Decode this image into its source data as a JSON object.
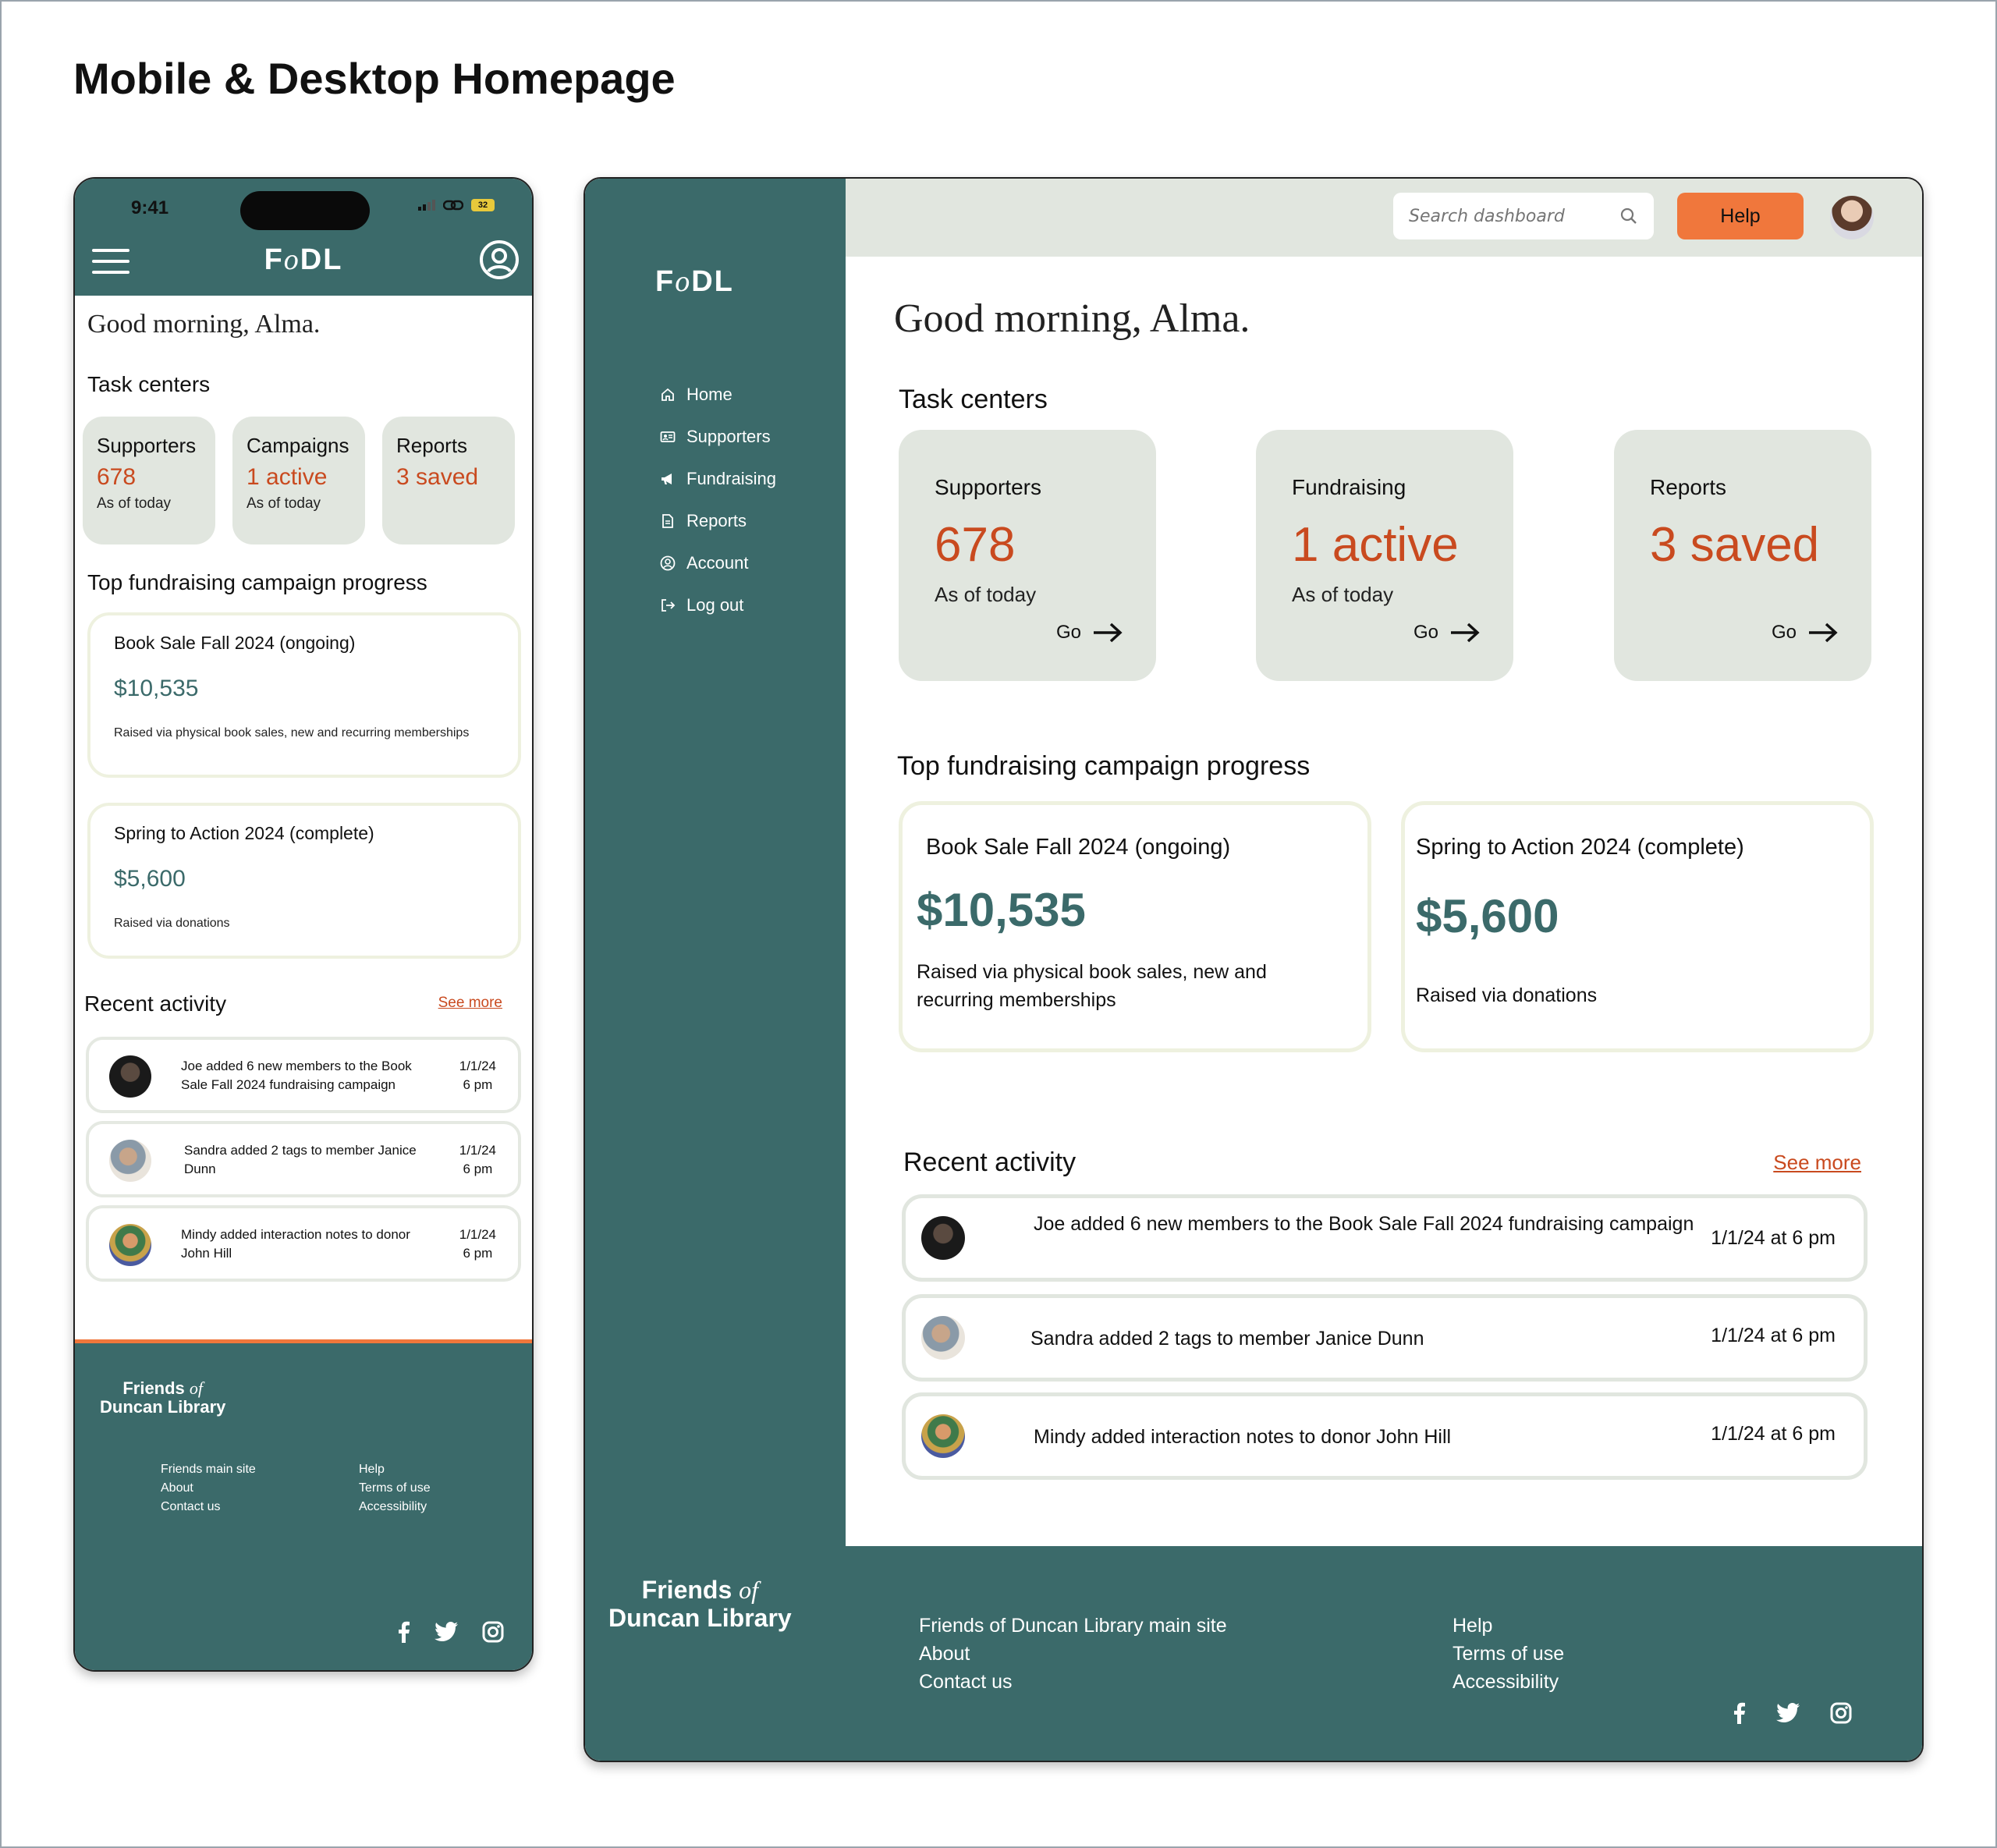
{
  "heading": "Mobile & Desktop Homepage",
  "brand": {
    "logo_a": "F",
    "logo_o": "o",
    "logo_b": "DL",
    "friends": "Friends",
    "of": "of",
    "library": "Duncan Library"
  },
  "colors": {
    "brand_teal": "#3b6a6a",
    "accent_orange": "#f0773c",
    "value_red": "#c94a1f",
    "card_gray": "#e1e6df"
  },
  "mobile": {
    "status_time": "9:41",
    "battery": "32",
    "greeting": "Good morning, Alma.",
    "task_centers_title": "Task centers",
    "task_cards": [
      {
        "label": "Supporters",
        "value": "678",
        "sub": "As of today"
      },
      {
        "label": "Campaigns",
        "value": "1 active",
        "sub": "As of today"
      },
      {
        "label": "Reports",
        "value": "3 saved",
        "sub": ""
      }
    ],
    "campaigns_title": "Top fundraising campaign progress",
    "campaigns": [
      {
        "name": "Book Sale Fall 2024 (ongoing)",
        "amount": "$10,535",
        "desc": "Raised via physical book sales, new and recurring memberships"
      },
      {
        "name": "Spring to Action 2024 (complete)",
        "amount": "$5,600",
        "desc": "Raised via donations"
      }
    ],
    "activity_title": "Recent activity",
    "see_more": "See more",
    "activity": [
      {
        "text": "Joe added 6 new members to the Book Sale Fall 2024 fundraising campaign",
        "date": "1/1/24",
        "time": "6 pm"
      },
      {
        "text": "Sandra added 2 tags to member Janice Dunn",
        "date": "1/1/24",
        "time": "6 pm"
      },
      {
        "text": "Mindy added interaction notes to donor John Hill",
        "date": "1/1/24",
        "time": "6 pm"
      }
    ],
    "footer_col1": [
      "Friends main site",
      "About",
      "Contact us"
    ],
    "footer_col2": [
      "Help",
      "Terms of use",
      "Accessibility"
    ]
  },
  "desktop": {
    "nav": [
      {
        "label": "Home",
        "icon": "home-icon"
      },
      {
        "label": "Supporters",
        "icon": "id-card-icon"
      },
      {
        "label": "Fundraising",
        "icon": "megaphone-icon"
      },
      {
        "label": "Reports",
        "icon": "document-icon"
      },
      {
        "label": "Account",
        "icon": "user-circle-icon"
      },
      {
        "label": "Log out",
        "icon": "logout-icon"
      }
    ],
    "search_placeholder": "Search dashboard",
    "help_label": "Help",
    "greeting": "Good morning, Alma.",
    "task_centers_title": "Task centers",
    "task_cards": [
      {
        "label": "Supporters",
        "value": "678",
        "sub": "As of today",
        "go": "Go"
      },
      {
        "label": "Fundraising",
        "value": "1 active",
        "sub": "As of today",
        "go": "Go"
      },
      {
        "label": "Reports",
        "value": "3 saved",
        "sub": "",
        "go": "Go"
      }
    ],
    "campaigns_title": "Top fundraising campaign progress",
    "campaigns": [
      {
        "name": "Book Sale Fall 2024 (ongoing)",
        "amount": "$10,535",
        "desc": "Raised via physical book sales, new and recurring memberships"
      },
      {
        "name": "Spring to Action 2024 (complete)",
        "amount": "$5,600",
        "desc": "Raised via donations"
      }
    ],
    "activity_title": "Recent activity",
    "see_more": "See more",
    "activity": [
      {
        "text": "Joe added 6 new members to the Book Sale Fall 2024 fundraising campaign",
        "date": "1/1/24 at 6 pm"
      },
      {
        "text": "Sandra added 2 tags to member Janice Dunn",
        "date": "1/1/24 at 6 pm"
      },
      {
        "text": "Mindy added interaction notes to donor John Hill",
        "date": "1/1/24 at 6 pm"
      }
    ],
    "footer_col1": [
      "Friends of Duncan Library main site",
      "About",
      "Contact us"
    ],
    "footer_col2": [
      "Help",
      "Terms of use",
      "Accessibility"
    ]
  }
}
